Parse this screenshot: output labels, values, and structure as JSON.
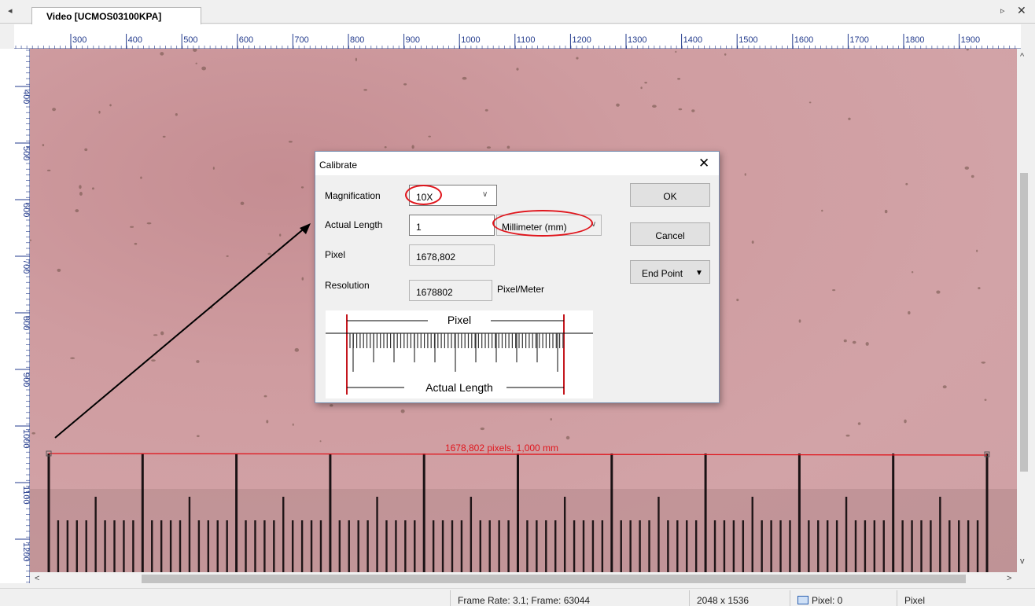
{
  "tab": {
    "title": "Video [UCMOS03100KPA]",
    "left_arrow": "◂",
    "right_arrow": "▹",
    "close": "✕"
  },
  "hruler_labels": [
    "300",
    "400",
    "500",
    "600",
    "700",
    "800",
    "900",
    "1000",
    "1100",
    "1200",
    "1300",
    "1400",
    "1500",
    "1600",
    "1700",
    "1800",
    "1900"
  ],
  "vruler_labels": [
    "400",
    "500",
    "600",
    "700",
    "800",
    "900",
    "1000",
    "1100",
    "1200"
  ],
  "measurement": {
    "label": "1678,802 pixels, 1,000 mm",
    "line_color": "#e0161d"
  },
  "dialog": {
    "title": "Calibrate",
    "close": "✕",
    "magnification_label": "Magnification",
    "magnification_value": "10X",
    "actual_length_label": "Actual Length",
    "actual_length_value": "1",
    "unit_value": "Millimeter (mm)",
    "pixel_label": "Pixel",
    "pixel_value": "1678,802",
    "resolution_label": "Resolution",
    "resolution_value": "1678802",
    "resolution_unit": "Pixel/Meter",
    "ok": "OK",
    "cancel": "Cancel",
    "endpoint": "End Point",
    "diagram_top": "Pixel",
    "diagram_bottom": "Actual Length"
  },
  "status": {
    "frame": "Frame Rate: 3.1; Frame: 63044",
    "size": "2048 x 1536",
    "pixel": "Pixel: 0",
    "unit": "Pixel"
  },
  "scroll": {
    "up": "^",
    "down": "v",
    "left": "<",
    "right": ">"
  },
  "colors": {
    "annotation": "#e0161d",
    "ruler_text": "#223a8c"
  }
}
